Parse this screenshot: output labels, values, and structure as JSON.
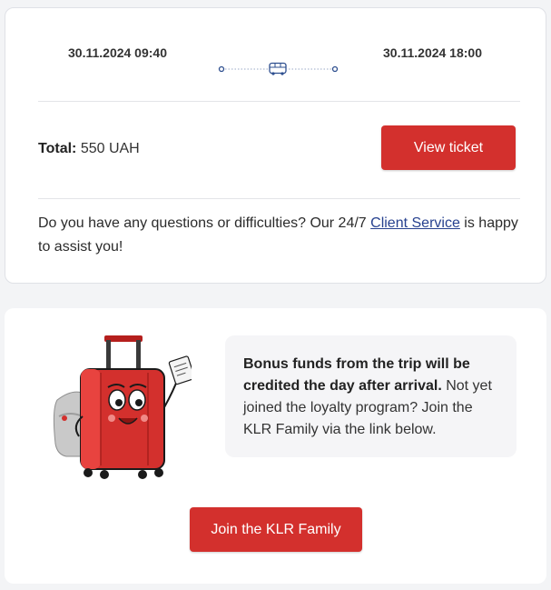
{
  "trip": {
    "departure": "30.11.2024 09:40",
    "arrival": "30.11.2024 18:00"
  },
  "icons": {
    "route_start": "dot-icon",
    "transport": "bus-icon",
    "route_end": "dot-icon"
  },
  "total": {
    "label": "Total:",
    "value": "550 UAH"
  },
  "actions": {
    "view_ticket": "View ticket",
    "join_family": "Join the KLR Family"
  },
  "help": {
    "text_before": "Do you have any questions or difficulties? Our 24/7 ",
    "link": "Client Service",
    "text_after": " is happy to assist you!"
  },
  "bonus": {
    "bold": "Bonus funds from the trip will be credited the day after arrival.",
    "rest": " Not yet joined the loyalty program? Join the KLR Family via the link below."
  },
  "colors": {
    "accent": "#d3302d",
    "link": "#27418f",
    "route_line": "#2e4f8f"
  }
}
